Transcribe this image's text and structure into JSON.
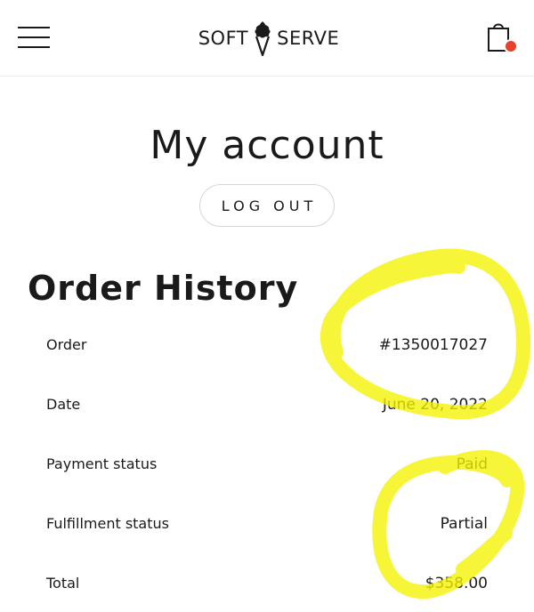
{
  "header": {
    "logo_left": "SOFT",
    "logo_right": "SERVE",
    "cart_badge_color": "#e8412c"
  },
  "account": {
    "title": "My account",
    "logout_label": "LOG OUT"
  },
  "order_history": {
    "title": "Order History",
    "rows": [
      {
        "label": "Order",
        "value": "#1350017027"
      },
      {
        "label": "Date",
        "value": "June 20, 2022"
      },
      {
        "label": "Payment status",
        "value": "Paid"
      },
      {
        "label": "Fulfillment status",
        "value": "Partial"
      },
      {
        "label": "Total",
        "value": "$358.00"
      }
    ]
  },
  "annotation": {
    "highlight_color": "#f5f200"
  }
}
